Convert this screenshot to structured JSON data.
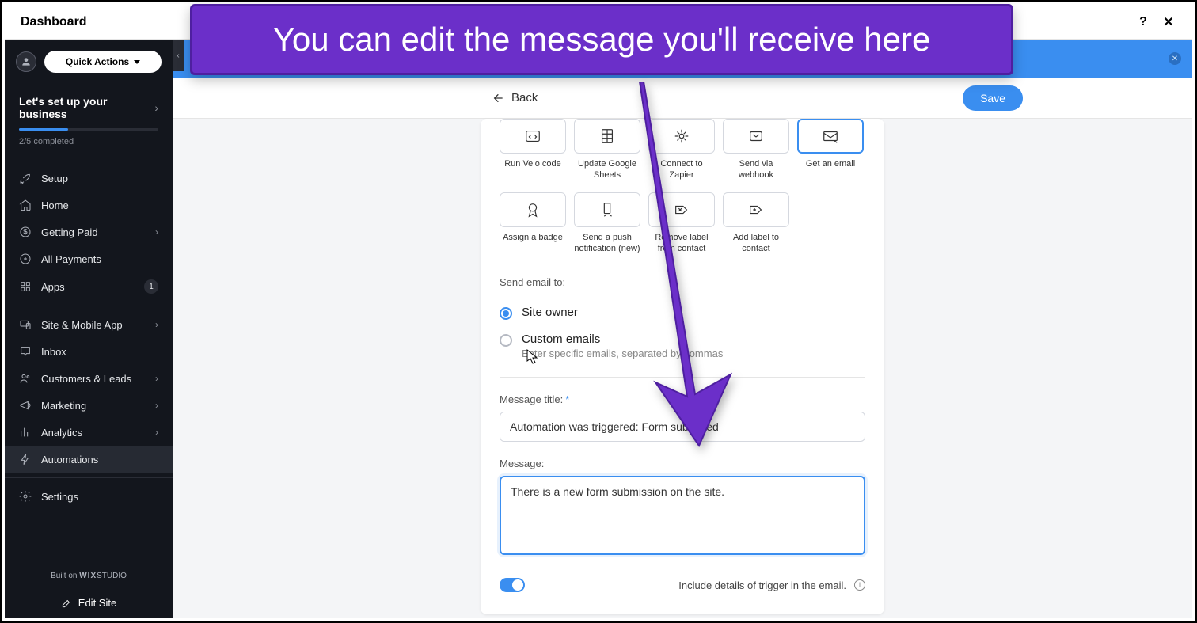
{
  "topbar": {
    "title": "Dashboard"
  },
  "sidebar": {
    "quick_actions": "Quick Actions",
    "setup": {
      "title": "Let's set up your business",
      "progress_text": "2/5 completed"
    },
    "items": [
      {
        "label": "Setup",
        "icon": "rocket"
      },
      {
        "label": "Home",
        "icon": "home"
      },
      {
        "label": "Getting Paid",
        "icon": "dollar",
        "chevron": true
      },
      {
        "label": "All Payments",
        "icon": "dollar2"
      },
      {
        "label": "Apps",
        "icon": "grid",
        "badge": "1"
      },
      {
        "divider": true
      },
      {
        "label": "Site & Mobile App",
        "icon": "devices",
        "chevron": true
      },
      {
        "label": "Inbox",
        "icon": "inbox"
      },
      {
        "label": "Customers & Leads",
        "icon": "users",
        "chevron": true
      },
      {
        "label": "Marketing",
        "icon": "megaphone",
        "chevron": true
      },
      {
        "label": "Analytics",
        "icon": "chart",
        "chevron": true
      },
      {
        "label": "Automations",
        "icon": "bolt",
        "active": true
      },
      {
        "divider": true
      },
      {
        "label": "Settings",
        "icon": "gear"
      }
    ],
    "footer": {
      "builton_prefix": "Built on ",
      "builton_brand": "WIX",
      "builton_suffix": "STUDIO",
      "edit_site": "Edit Site"
    }
  },
  "header": {
    "back": "Back",
    "save": "Save"
  },
  "tiles_row1": [
    {
      "label": "Run Velo code",
      "icon": "code"
    },
    {
      "label": "Update Google Sheets",
      "icon": "sheets"
    },
    {
      "label": "Connect to Zapier",
      "icon": "zapier"
    },
    {
      "label": "Send via webhook",
      "icon": "webhook"
    },
    {
      "label": "Get an email",
      "icon": "email",
      "selected": true
    }
  ],
  "tiles_row2": [
    {
      "label": "Assign a badge",
      "icon": "badge"
    },
    {
      "label": "Send a push notification (new)",
      "icon": "push"
    },
    {
      "label": "Remove label from contact",
      "icon": "labelremove"
    },
    {
      "label": "Add label to contact",
      "icon": "labeladd"
    }
  ],
  "form": {
    "send_to_label": "Send email to:",
    "radio_owner": "Site owner",
    "radio_custom": "Custom emails",
    "radio_custom_sub": "Enter specific emails, separated by commas",
    "title_label": "Message title:",
    "title_value": "Automation was triggered: Form submitted",
    "message_label": "Message:",
    "message_value": "There is a new form submission on the site.",
    "toggle_label": "Include details of trigger in the email."
  },
  "annotation": {
    "text": "You can edit the message you'll receive here"
  }
}
